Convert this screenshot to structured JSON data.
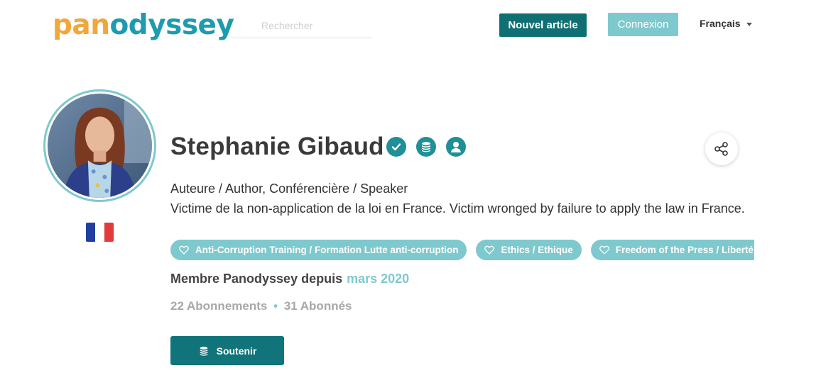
{
  "header": {
    "logo_part1": "pan",
    "logo_part2": "odyssey",
    "search_placeholder": "Rechercher",
    "new_article_label": "Nouvel article",
    "login_label": "Connexion",
    "language_label": "Français"
  },
  "profile": {
    "name": "Stephanie Gibaud",
    "role": "Auteure / Author, Conférencière / Speaker",
    "bio": "Victime de la non-application de la loi en France. Victim wronged by failure to apply the law in France.",
    "tags": [
      "Anti-Corruption Training / Formation Lutte anti-corruption",
      "Ethics / Ethique",
      "Freedom of the Press / Liberté de la Presse"
    ],
    "member_label": "Membre Panodyssey depuis",
    "member_since": "mars 2020",
    "following": "22 Abonnements",
    "separator": "•",
    "followers": "31 Abonnés",
    "support_label": "Soutenir"
  },
  "icons": {
    "verified": "verified-check-icon",
    "coins": "coins-icon",
    "supporter": "supporter-icon",
    "share": "share-icon",
    "heart": "heart-icon",
    "flag": "france-flag"
  },
  "colors": {
    "teal_dark": "#0f6f73",
    "teal_light": "#7ec9cd",
    "badge": "#208f97",
    "logo_orange": "#f0a83a",
    "logo_blue": "#1e9bb0",
    "flag_blue": "#1f3fa0",
    "flag_red": "#e23b3b"
  }
}
